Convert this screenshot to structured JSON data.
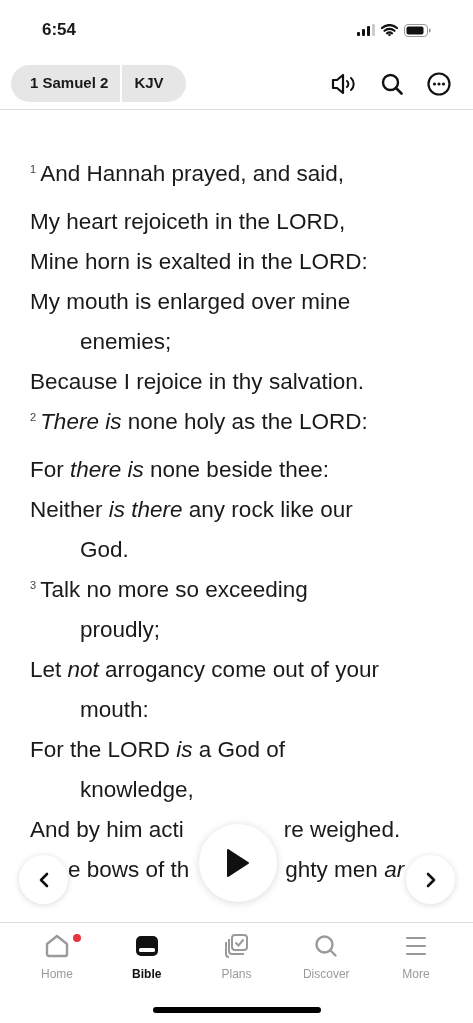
{
  "status_bar": {
    "time": "6:54"
  },
  "header": {
    "book": "1 Samuel 2",
    "version": "KJV"
  },
  "lines": [
    {
      "kind": "verse",
      "number": "1",
      "text": "And Hannah prayed, and said,"
    },
    {
      "kind": "stanza",
      "text": "My heart rejoiceth in the LORD,"
    },
    {
      "kind": "line",
      "text": "Mine horn is exalted in the LORD:"
    },
    {
      "kind": "line",
      "text": "My mouth is enlarged over mine"
    },
    {
      "kind": "continuation",
      "text": "enemies;"
    },
    {
      "kind": "line",
      "text": "Because I rejoice in thy salvation."
    },
    {
      "kind": "verse",
      "number": "2",
      "text": "*There is* none holy as the LORD:"
    },
    {
      "kind": "stanza",
      "text": "For *there is* none beside thee:"
    },
    {
      "kind": "line",
      "text": "Neither *is there* any rock like our"
    },
    {
      "kind": "continuation",
      "text": "God."
    },
    {
      "kind": "verse",
      "number": "3",
      "text": "Talk no more so exceeding"
    },
    {
      "kind": "continuation",
      "text": "proudly;"
    },
    {
      "kind": "line",
      "text": "Let *not* arrogancy come out of your"
    },
    {
      "kind": "continuation",
      "text": "mouth:"
    },
    {
      "kind": "line",
      "text": "For the LORD *is* a God of"
    },
    {
      "kind": "continuation",
      "text": "knowledge,"
    }
  ],
  "obscured_lines": [
    {
      "segments": [
        "And by him acti",
        "re weighed."
      ]
    },
    {
      "segments": [
        "e bows of th",
        "ghty men *ar*"
      ]
    }
  ],
  "tabs": [
    {
      "label": "Home",
      "selected": false,
      "badge": true
    },
    {
      "label": "Bible",
      "selected": true,
      "badge": false
    },
    {
      "label": "Plans",
      "selected": false,
      "badge": false
    },
    {
      "label": "Discover",
      "selected": false,
      "badge": false
    },
    {
      "label": "More",
      "selected": false,
      "badge": false
    }
  ]
}
